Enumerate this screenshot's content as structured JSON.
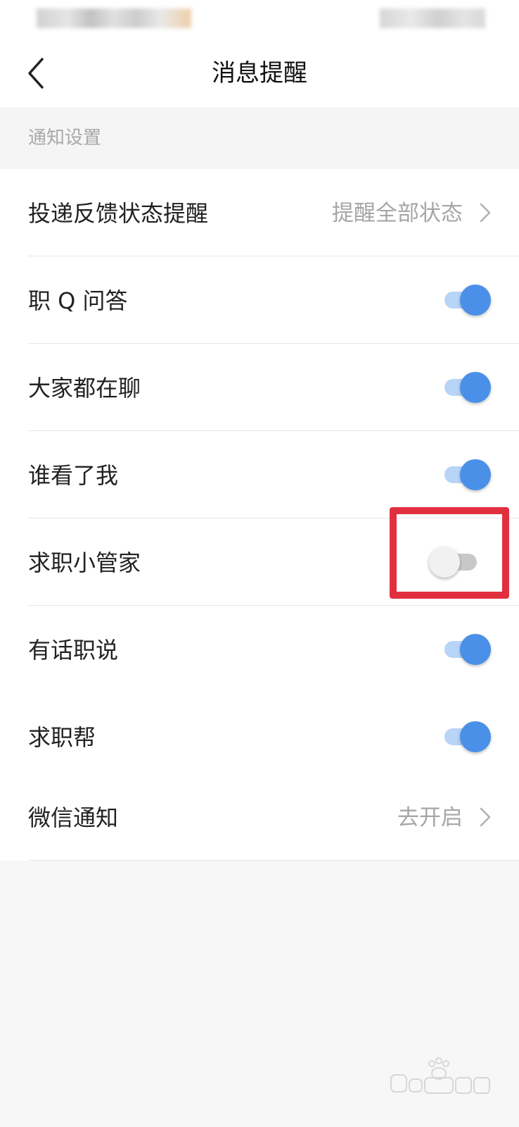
{
  "header": {
    "title": "消息提醒"
  },
  "section": {
    "title": "通知设置"
  },
  "settings": [
    {
      "label": "投递反馈状态提醒",
      "type": "link",
      "value": "提醒全部状态"
    },
    {
      "label": "职 Q 问答",
      "type": "toggle",
      "on": true
    },
    {
      "label": "大家都在聊",
      "type": "toggle",
      "on": true
    },
    {
      "label": "谁看了我",
      "type": "toggle",
      "on": true
    },
    {
      "label": "求职小管家",
      "type": "toggle",
      "on": false
    },
    {
      "label": "有话职说",
      "type": "toggle",
      "on": true
    },
    {
      "label": "求职帮",
      "type": "toggle",
      "on": true
    }
  ],
  "wechat": {
    "label": "微信通知",
    "value": "去开启"
  },
  "colors": {
    "toggle_on_knob": "#4a90e8",
    "toggle_on_track": "#b8d4f6",
    "toggle_off_knob": "#f1f1f1",
    "toggle_off_track": "#c8c8c8",
    "highlight": "#e0303f"
  },
  "icons": {
    "back": "chevron-left-icon",
    "row_link": "chevron-right-icon"
  }
}
